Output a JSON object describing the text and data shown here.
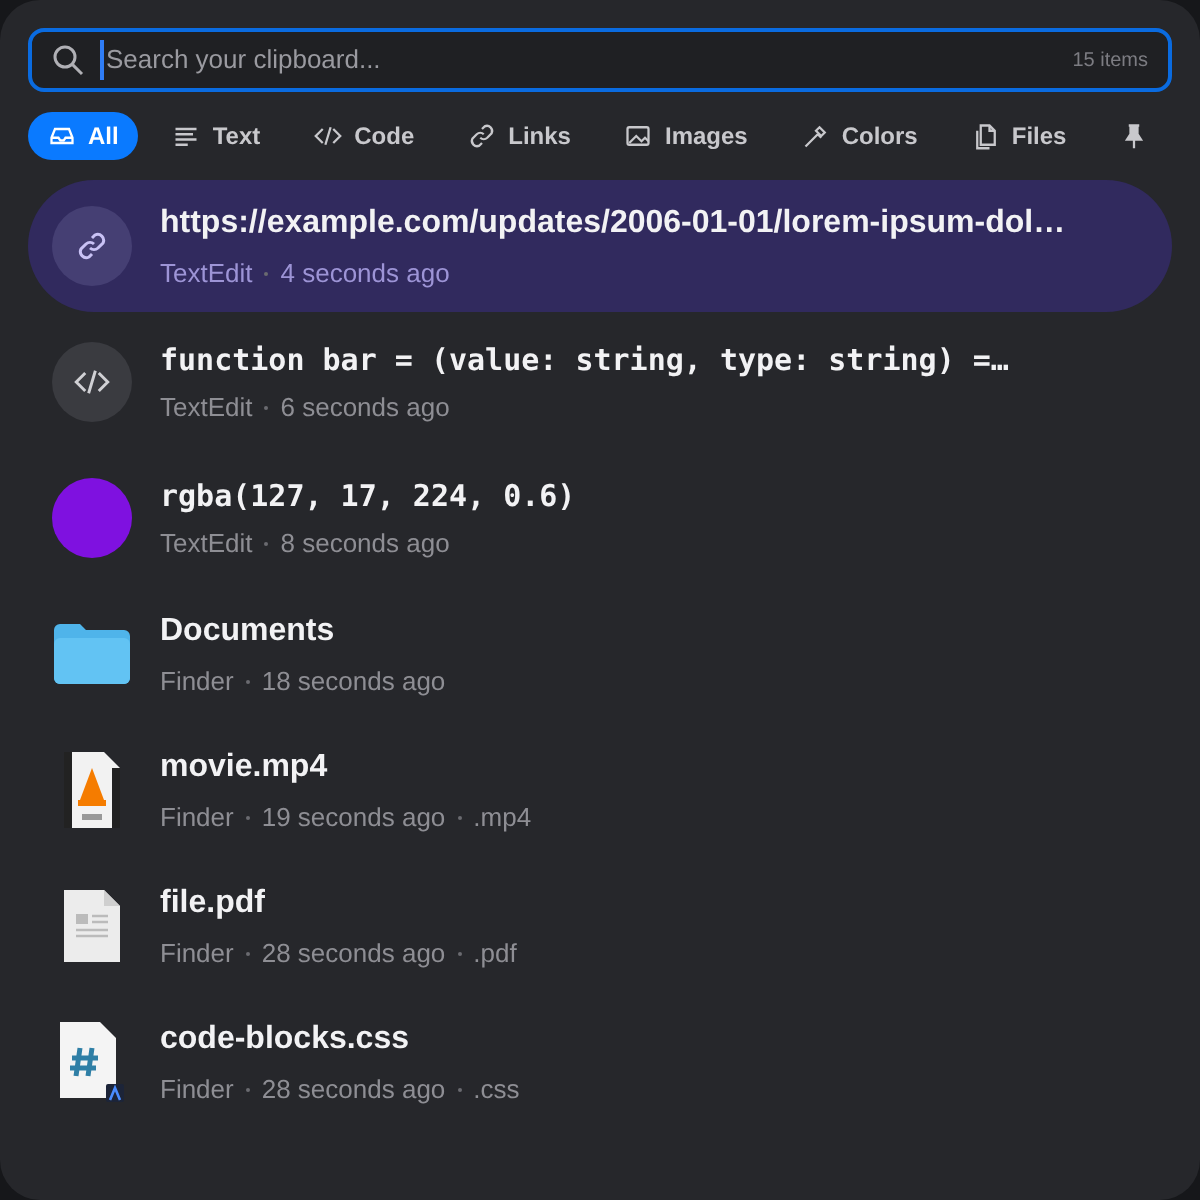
{
  "search": {
    "placeholder": "Search your clipboard...",
    "count": "15 items"
  },
  "filters": [
    {
      "label": "All",
      "kind": "all",
      "selected": true
    },
    {
      "label": "Text",
      "kind": "text",
      "selected": false
    },
    {
      "label": "Code",
      "kind": "code",
      "selected": false
    },
    {
      "label": "Links",
      "kind": "links",
      "selected": false
    },
    {
      "label": "Images",
      "kind": "images",
      "selected": false
    },
    {
      "label": "Colors",
      "kind": "colors",
      "selected": false
    },
    {
      "label": "Files",
      "kind": "files",
      "selected": false
    },
    {
      "kind": "pinned",
      "selected": false
    }
  ],
  "items": [
    {
      "kind": "link",
      "title": "https://example.com/updates/2006-01-01/lorem-ipsum-dol…",
      "source": "TextEdit",
      "time": "4 seconds ago",
      "selected": true
    },
    {
      "kind": "code",
      "title": "function bar = (value: string, type: string) =…",
      "source": "TextEdit",
      "time": "6 seconds ago",
      "selected": false
    },
    {
      "kind": "color",
      "title": "rgba(127, 17, 224, 0.6)",
      "source": "TextEdit",
      "time": "8 seconds ago",
      "color": "#7f11e0",
      "selected": false
    },
    {
      "kind": "folder",
      "title": "Documents",
      "source": "Finder",
      "time": "18 seconds ago",
      "selected": false
    },
    {
      "kind": "video",
      "title": "movie.mp4",
      "source": "Finder",
      "time": "19 seconds ago",
      "ext": ".mp4",
      "selected": false
    },
    {
      "kind": "pdf",
      "title": "file.pdf",
      "source": "Finder",
      "time": "28 seconds ago",
      "ext": ".pdf",
      "selected": false
    },
    {
      "kind": "css",
      "title": "code-blocks.css",
      "source": "Finder",
      "time": "28 seconds ago",
      "ext": ".css",
      "selected": false
    }
  ]
}
